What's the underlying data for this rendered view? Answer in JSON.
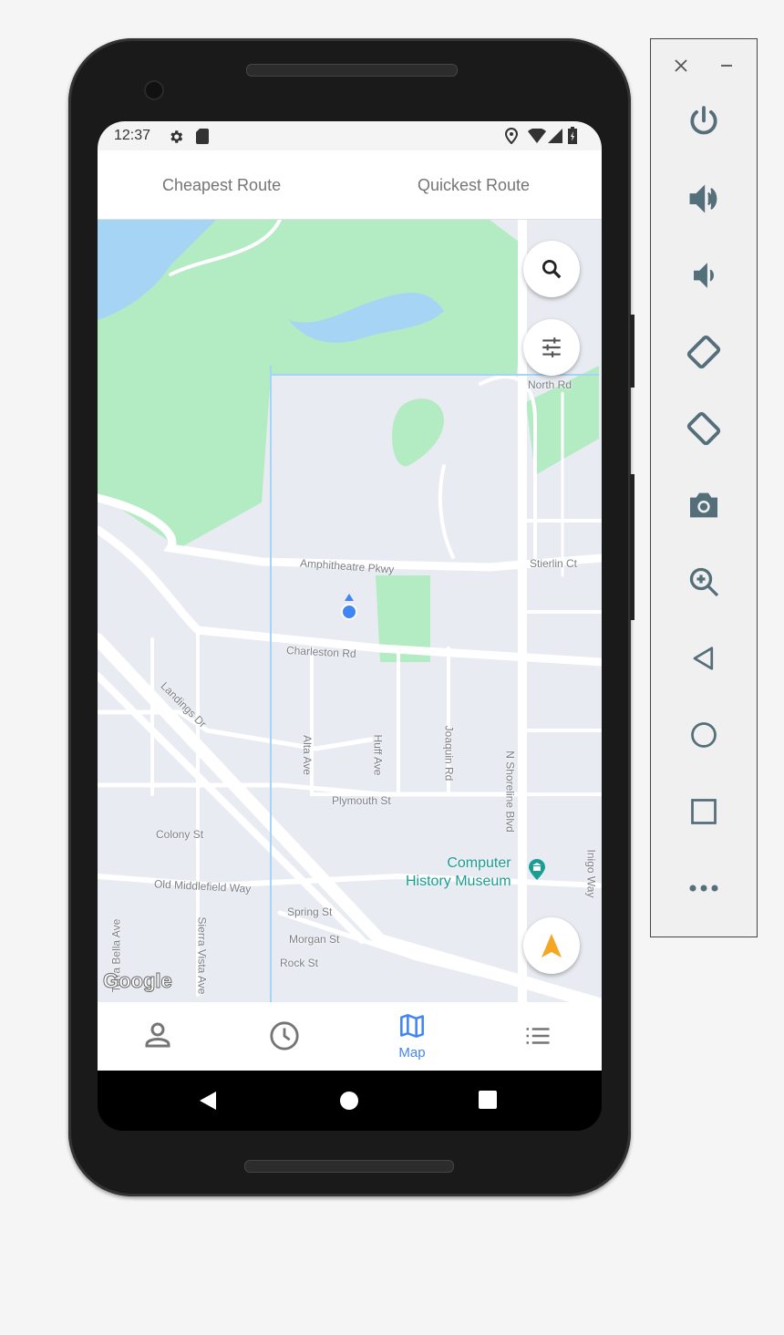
{
  "status_bar": {
    "time": "12:37",
    "icons": [
      "settings-icon",
      "sd-card-icon",
      "location-icon",
      "wifi-icon",
      "signal-icon",
      "battery-charging-icon"
    ]
  },
  "tabs": [
    {
      "label": "Cheapest Route"
    },
    {
      "label": "Quickest Route"
    }
  ],
  "map": {
    "labels": {
      "amphitheatre": "Amphitheatre Pkwy",
      "charleston": "Charleston Rd",
      "landings": "Landings Dr",
      "alta": "Alta Ave",
      "huff": "Huff Ave",
      "joaquin": "Joaquin Rd",
      "shoreline": "N Shoreline Blvd",
      "plymouth": "Plymouth St",
      "colony": "Colony St",
      "old_middlefield": "Old Middlefield Way",
      "spring": "Spring St",
      "morgan": "Morgan St",
      "rock": "Rock St",
      "sierra_vista": "Sierra Vista Ave",
      "north_rd": "North Rd",
      "stierlin": "Stierlin Ct",
      "inigo": "Inigo Way",
      "terra_bella": "Terra Bella Ave"
    },
    "poi": {
      "name_line1": "Computer",
      "name_line2": "History Museum",
      "icon": "museum-icon",
      "color": "#1a9e94"
    },
    "logo": "Google",
    "colors": {
      "land": "#e8ebf1",
      "park": "#b3ebc3",
      "water": "#a6d4f5",
      "road": "#ffffff",
      "accent": "#4285f4"
    }
  },
  "fabs": {
    "search": "search-icon",
    "filter": "tune-icon",
    "navigate": "navigation-arrow-icon",
    "navigate_color": "#f5a623"
  },
  "bottom_nav": [
    {
      "icon": "person-icon",
      "label": ""
    },
    {
      "icon": "clock-icon",
      "label": ""
    },
    {
      "icon": "map-icon",
      "label": "Map",
      "active": true
    },
    {
      "icon": "list-icon",
      "label": ""
    }
  ],
  "bottom_nav_active_color": "#4285f4",
  "emulator_panel": {
    "buttons": [
      "close-icon",
      "minimize-icon",
      "power-icon",
      "volume-up-icon",
      "volume-down-icon",
      "rotate-left-icon",
      "rotate-right-icon",
      "camera-icon",
      "zoom-icon",
      "back-icon",
      "home-icon",
      "overview-icon",
      "more-icon"
    ]
  }
}
